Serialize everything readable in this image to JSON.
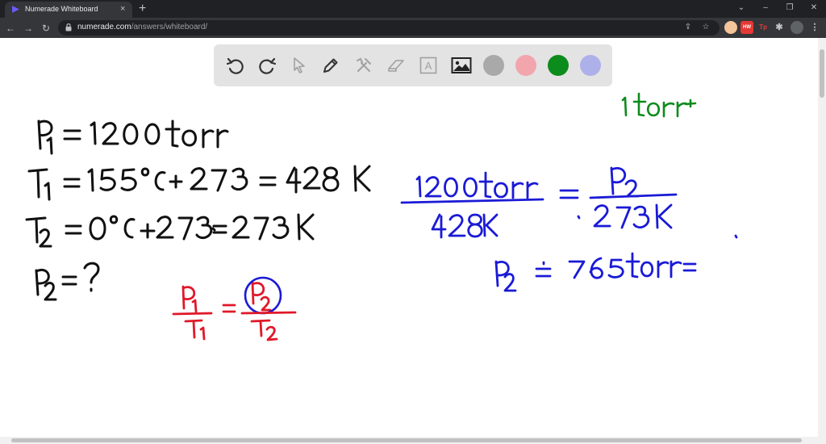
{
  "browser": {
    "tab_title": "Numerade Whiteboard",
    "tab_close": "×",
    "new_tab": "+",
    "url_host": "numerade.com",
    "url_path": "/answers/whiteboard/",
    "extensions": [
      {
        "name": "hw-extension",
        "label": "HW",
        "color": "#e53935"
      },
      {
        "name": "tp-extension",
        "label": "Tp",
        "color": "#e53935"
      }
    ]
  },
  "whiteboard": {
    "tools": [
      "undo-icon",
      "redo-icon",
      "select-icon",
      "pen-icon",
      "tools-icon",
      "eraser-icon",
      "text-icon",
      "image-icon"
    ],
    "text_tool_label": "A",
    "colors": [
      "#a9a9a9",
      "#f2a5ad",
      "#0c8c1c",
      "#aeb0ea"
    ],
    "selected_color": "#0c8c1c"
  },
  "handwriting": {
    "given": [
      "P₁ = 1200 torr",
      "T₁ = 155°C + 273 = 428 K",
      "T₂ = 0°C + 273 = 273 K",
      "P₂ = ?"
    ],
    "formula": "P₁/T₁ = P₂/T₂",
    "equation": "1200 torr / 428 K = P₂ / 273 K",
    "answer": "P₂ = 765 torr =",
    "note": "1 torr ="
  }
}
